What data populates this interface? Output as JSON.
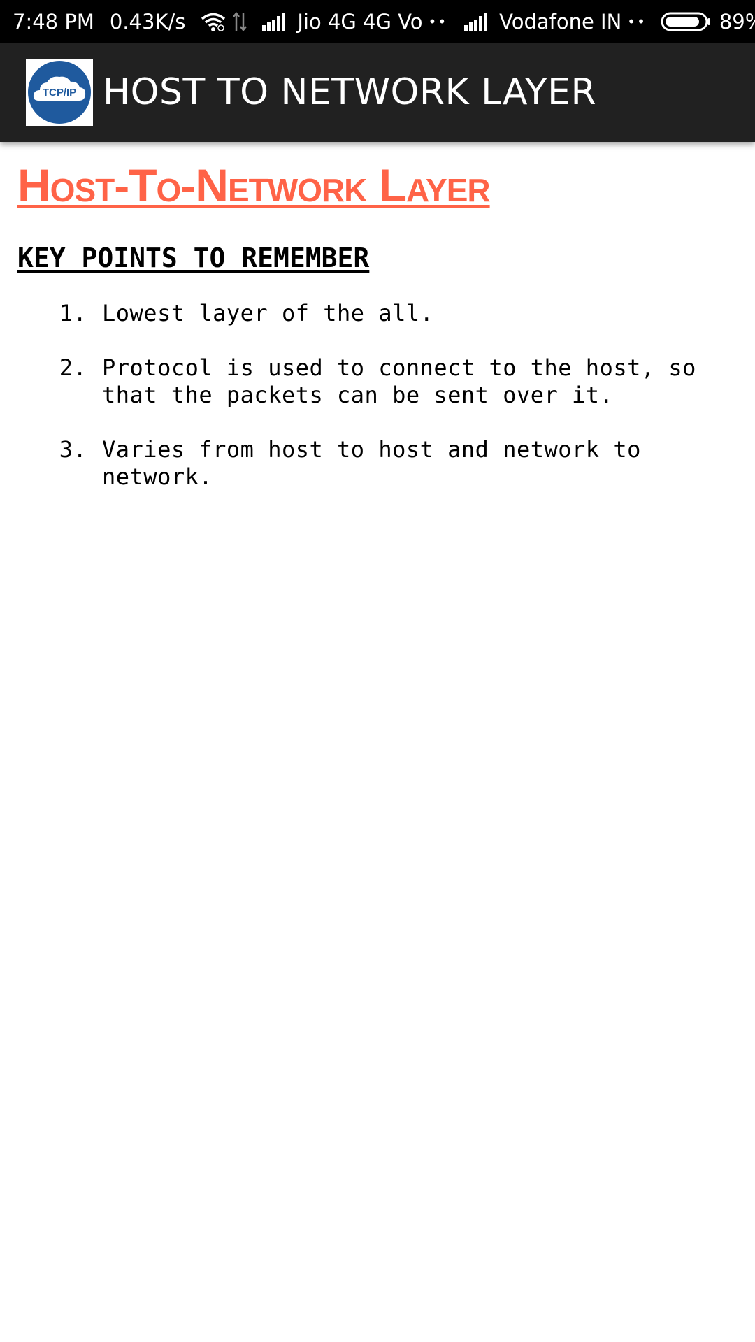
{
  "status_bar": {
    "time": "7:48 PM",
    "speed": "0.43K/s",
    "carrier1": "Jio 4G 4G Vo",
    "dots1": "••",
    "carrier2": "Vodafone IN",
    "dots2": "••",
    "battery": "89%",
    "battery_level": 0.89
  },
  "app_bar": {
    "logo_text": "TCP/IP",
    "title": "HOST TO NETWORK LAYER"
  },
  "content": {
    "title": "Host-To-Network Layer",
    "section_heading": "KEY POINTS TO REMEMBER",
    "points": [
      "Lowest layer of the all.",
      "Protocol is used to connect to the host, so that the packets can be sent over it.",
      "Varies from host to host and network to network."
    ]
  },
  "colors": {
    "title_accent": "#ff6347",
    "app_bar_bg": "#212121",
    "status_bar_bg": "#000000",
    "logo_blue": "#1f5a9e"
  },
  "icons": [
    "wifi-icon",
    "data-arrows-icon",
    "signal-icon",
    "battery-icon",
    "tcp-ip-logo"
  ]
}
